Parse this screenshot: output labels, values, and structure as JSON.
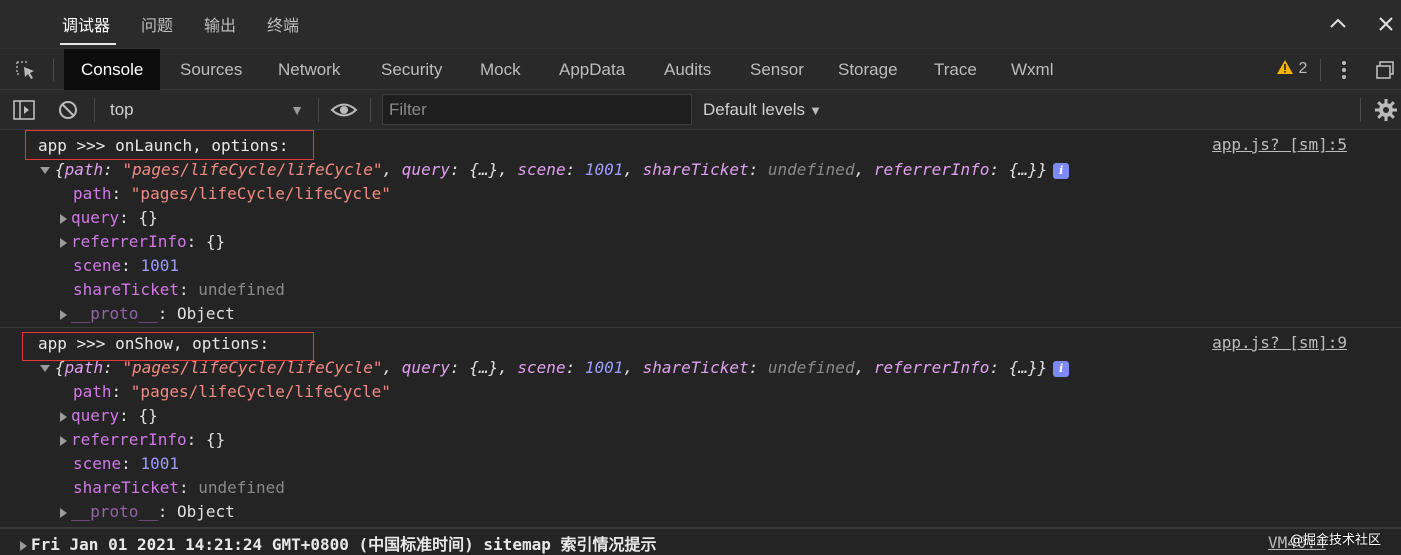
{
  "top_tabs": [
    "调试器",
    "问题",
    "输出",
    "终端"
  ],
  "devtools_tabs": [
    "Console",
    "Sources",
    "Network",
    "Security",
    "Mock",
    "AppData",
    "Audits",
    "Sensor",
    "Storage",
    "Trace",
    "Wxml"
  ],
  "warnings_count": "2",
  "toolbar": {
    "context": "top",
    "filter_placeholder": "Filter",
    "levels": "Default levels"
  },
  "messages": [
    {
      "text": "app >>> onLaunch, options:",
      "source": "app.js? [sm]:5",
      "summary": {
        "path_key": "path",
        "path_val": "\"pages/lifeCycle/lifeCycle\"",
        "query_key": "query",
        "query_val": "{…}",
        "scene_key": "scene",
        "scene_val": "1001",
        "share_key": "shareTicket",
        "share_val": "undefined",
        "ref_key": "referrerInfo",
        "ref_val": "{…}"
      },
      "props": {
        "path_key": "path",
        "path_val": "\"pages/lifeCycle/lifeCycle\"",
        "query_key": "query",
        "query_val": "{}",
        "ref_key": "referrerInfo",
        "ref_val": "{}",
        "scene_key": "scene",
        "scene_val": "1001",
        "share_key": "shareTicket",
        "share_val": "undefined",
        "proto_key": "__proto__",
        "proto_val": "Object"
      }
    },
    {
      "text": "app >>> onShow, options:",
      "source": "app.js? [sm]:9",
      "summary": {
        "path_key": "path",
        "path_val": "\"pages/lifeCycle/lifeCycle\"",
        "query_key": "query",
        "query_val": "{…}",
        "scene_key": "scene",
        "scene_val": "1001",
        "share_key": "shareTicket",
        "share_val": "undefined",
        "ref_key": "referrerInfo",
        "ref_val": "{…}"
      },
      "props": {
        "path_key": "path",
        "path_val": "\"pages/lifeCycle/lifeCycle\"",
        "query_key": "query",
        "query_val": "{}",
        "ref_key": "referrerInfo",
        "ref_val": "{}",
        "scene_key": "scene",
        "scene_val": "1001",
        "share_key": "shareTicket",
        "share_val": "undefined",
        "proto_key": "__proto__",
        "proto_val": "Object"
      }
    }
  ],
  "bottom_message": {
    "text": "Fri Jan 01 2021 14:21:24 GMT+0800 (中国标准时间) sitemap 索引情况提示",
    "source": "VM40:4"
  },
  "watermark": "@掘金技术社区",
  "icons": [
    "inspect-icon",
    "chevron-up-icon",
    "close-icon",
    "warning-icon",
    "kebab-menu-icon",
    "dock-icon",
    "sidebar-toggle-icon",
    "clear-console-icon",
    "eye-icon",
    "gear-icon",
    "info-icon"
  ],
  "colors": {
    "background": "#242424",
    "active_tab": "#0c0c0c",
    "highlight_box": "#e53935",
    "string": "#f28b82",
    "number": "#9d9bff",
    "key": "#d178e8",
    "warning": "#f5b400"
  }
}
